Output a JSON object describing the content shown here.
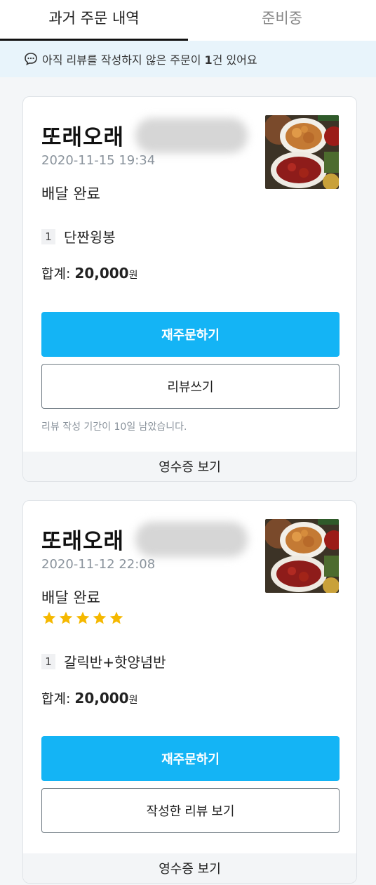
{
  "tabs": [
    {
      "label": "과거 주문 내역",
      "active": true
    },
    {
      "label": "준비중",
      "active": false
    }
  ],
  "review_notice": {
    "prefix": "아직 리뷰를 작성하지 않은 주문이 ",
    "count": "1",
    "suffix": "건 있어요",
    "icon": "chat-bubble-icon"
  },
  "orders": [
    {
      "store": "또래오래",
      "datetime": "2020-11-15 19:34",
      "status": "배달 완료",
      "qty": "1",
      "item": "단짠윙봉",
      "total_label": "합계: ",
      "total_amount": "20,000",
      "currency": "원",
      "reorder_label": "재주문하기",
      "review_label": "리뷰쓰기",
      "review_period": "리뷰 작성 기간이 10일 남았습니다.",
      "receipt_label": "영수증 보기"
    },
    {
      "store": "또래오래",
      "datetime": "2020-11-12 22:08",
      "status": "배달 완료",
      "rating": 5,
      "qty": "1",
      "item": "갈릭반+핫양념반",
      "total_label": "합계: ",
      "total_amount": "20,000",
      "currency": "원",
      "reorder_label": "재주문하기",
      "review_label": "작성한 리뷰 보기",
      "receipt_label": "영수증 보기"
    }
  ],
  "colors": {
    "primary": "#14b4f5",
    "notice_bg": "#e8f4fb",
    "star": "#f5b800",
    "muted": "#8a939c"
  }
}
